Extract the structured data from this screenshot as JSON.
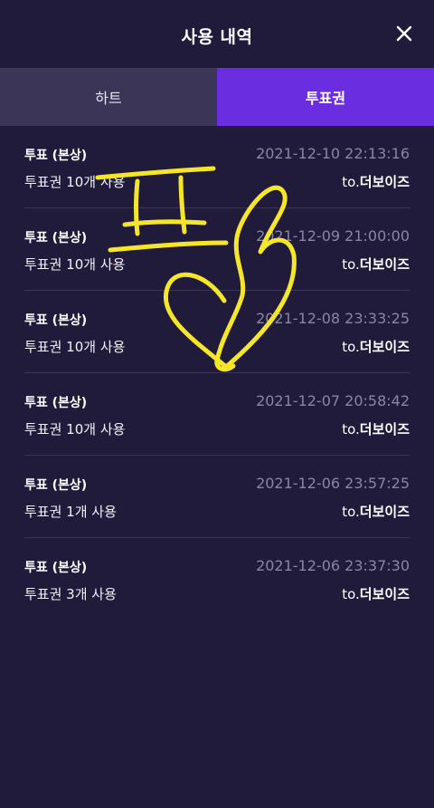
{
  "header": {
    "title": "사용 내역",
    "close_icon": "close-icon"
  },
  "tabs": [
    {
      "label": "하트",
      "active": false
    },
    {
      "label": "투표권",
      "active": true
    }
  ],
  "colors": {
    "background": "#211b3b",
    "active_tab": "#6a2ee0",
    "inactive_tab": "#3b3558",
    "date_text": "#8a84a6",
    "annotation": "#f5e62a"
  },
  "history": [
    {
      "type": "투표 (본상)",
      "date": "2021-12-10 22:13:16",
      "desc": "투표권 10개 사용",
      "to_prefix": "to.",
      "to_name": "더보이즈"
    },
    {
      "type": "투표 (본상)",
      "date": "2021-12-09 21:00:00",
      "desc": "투표권 10개 사용",
      "to_prefix": "to.",
      "to_name": "더보이즈"
    },
    {
      "type": "투표 (본상)",
      "date": "2021-12-08 23:33:25",
      "desc": "투표권 10개 사용",
      "to_prefix": "to.",
      "to_name": "더보이즈"
    },
    {
      "type": "투표 (본상)",
      "date": "2021-12-07 20:58:42",
      "desc": "투표권 10개 사용",
      "to_prefix": "to.",
      "to_name": "더보이즈"
    },
    {
      "type": "투표 (본상)",
      "date": "2021-12-06 23:57:25",
      "desc": "투표권 1개 사용",
      "to_prefix": "to.",
      "to_name": "더보이즈"
    },
    {
      "type": "투표 (본상)",
      "date": "2021-12-06 23:37:30",
      "desc": "투표권 3개 사용",
      "to_prefix": "to.",
      "to_name": "더보이즈"
    }
  ],
  "annotation": {
    "text": "표",
    "icon": "heart-doodle"
  }
}
